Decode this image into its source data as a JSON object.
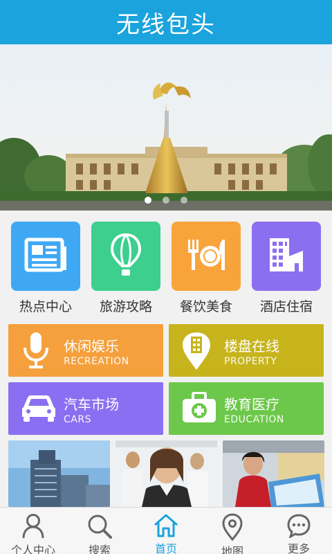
{
  "header": {
    "title": "无线包头"
  },
  "banner": {
    "slides": 3,
    "active": 0
  },
  "categories": [
    {
      "label": "热点中心",
      "icon": "newspaper-icon",
      "color": "#3fa8f4"
    },
    {
      "label": "旅游攻略",
      "icon": "balloon-icon",
      "color": "#3ccf8e"
    },
    {
      "label": "餐饮美食",
      "icon": "dining-icon",
      "color": "#f9a43b"
    },
    {
      "label": "酒店住宿",
      "icon": "hotel-icon",
      "color": "#8c6ff0"
    }
  ],
  "cards": [
    {
      "cn": "休闲娱乐",
      "en": "RECREATION",
      "icon": "microphone-icon",
      "color": "#f5a03c"
    },
    {
      "cn": "楼盘在线",
      "en": "PROPERTY",
      "icon": "location-building-icon",
      "color": "#c7b41c"
    },
    {
      "cn": "汽车市场",
      "en": "CARS",
      "icon": "car-icon",
      "color": "#8b6ff2"
    },
    {
      "cn": "教育医疗",
      "en": "EDUCATION",
      "icon": "medical-kit-icon",
      "color": "#6cc84a"
    }
  ],
  "tabs": [
    {
      "label": "个人中心",
      "icon": "person-icon"
    },
    {
      "label": "搜索",
      "icon": "search-icon"
    },
    {
      "label": "首页",
      "icon": "home-icon",
      "active": true
    },
    {
      "label": "地图",
      "icon": "map-pin-icon"
    },
    {
      "label": "更多",
      "icon": "more-icon"
    }
  ]
}
